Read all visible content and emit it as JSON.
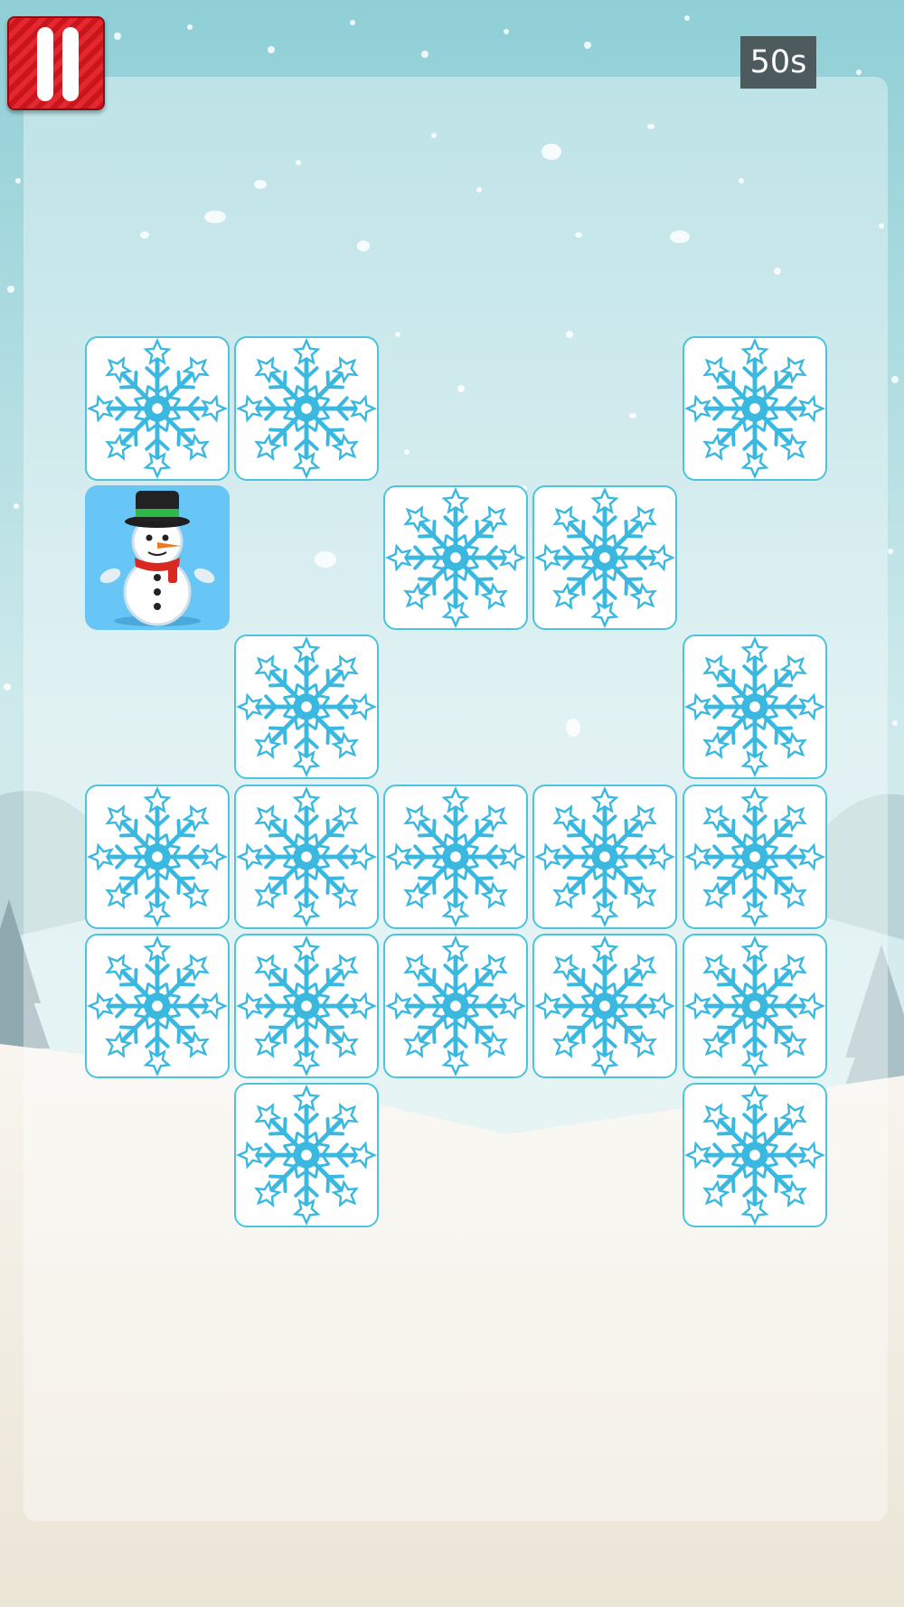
{
  "game": {
    "timer_text": "50s",
    "pause_icon": "pause-icon",
    "back_icon": "snowflake-icon",
    "face_icon": "snowman-icon",
    "colors": {
      "sky_top": "#8fcfd6",
      "sky_mid": "#cfeaec",
      "snow_ground": "#f4f1ea",
      "card_border": "#4dc4dc",
      "snowflake": "#3bb8e0",
      "pause_button": "#e5282f",
      "timer_bg": "#4d5b5e",
      "snowman_card_bg": "#67c6f5"
    },
    "grid": {
      "rows": 6,
      "cols": 5
    },
    "cards": [
      {
        "row": 1,
        "col": 1,
        "state": "face-down"
      },
      {
        "row": 1,
        "col": 2,
        "state": "face-down"
      },
      {
        "row": 1,
        "col": 5,
        "state": "face-down"
      },
      {
        "row": 2,
        "col": 1,
        "state": "face-up",
        "face": "snowman"
      },
      {
        "row": 2,
        "col": 3,
        "state": "face-down"
      },
      {
        "row": 2,
        "col": 4,
        "state": "face-down"
      },
      {
        "row": 3,
        "col": 2,
        "state": "face-down"
      },
      {
        "row": 3,
        "col": 5,
        "state": "face-down"
      },
      {
        "row": 4,
        "col": 1,
        "state": "face-down"
      },
      {
        "row": 4,
        "col": 2,
        "state": "face-down"
      },
      {
        "row": 4,
        "col": 3,
        "state": "face-down"
      },
      {
        "row": 4,
        "col": 4,
        "state": "face-down"
      },
      {
        "row": 4,
        "col": 5,
        "state": "face-down"
      },
      {
        "row": 5,
        "col": 1,
        "state": "face-down"
      },
      {
        "row": 5,
        "col": 2,
        "state": "face-down"
      },
      {
        "row": 5,
        "col": 3,
        "state": "face-down"
      },
      {
        "row": 5,
        "col": 4,
        "state": "face-down"
      },
      {
        "row": 5,
        "col": 5,
        "state": "face-down"
      },
      {
        "row": 6,
        "col": 2,
        "state": "face-down"
      },
      {
        "row": 6,
        "col": 5,
        "state": "face-down"
      }
    ]
  }
}
